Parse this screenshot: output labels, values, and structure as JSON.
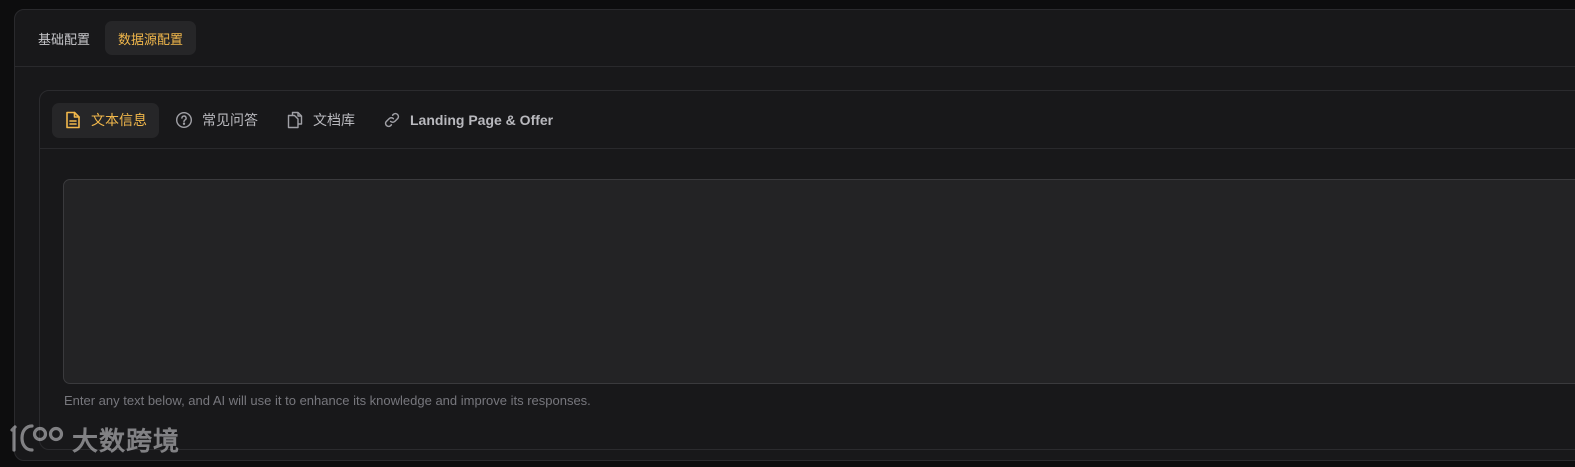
{
  "top_tabs": [
    {
      "label": "基础配置",
      "active": false
    },
    {
      "label": "数据源配置",
      "active": true
    }
  ],
  "sub_tabs": [
    {
      "label": "文本信息",
      "icon": "document-icon",
      "active": true
    },
    {
      "label": "常见问答",
      "icon": "question-circle-icon",
      "active": false
    },
    {
      "label": "文档库",
      "icon": "copy-icon",
      "active": false
    },
    {
      "label": "Landing Page & Offer",
      "icon": "link-icon",
      "active": false
    }
  ],
  "text_input": {
    "value": "",
    "placeholder": ""
  },
  "hint": "Enter any text below, and AI will use it to enhance its knowledge and improve its responses.",
  "watermark": {
    "text": "大数跨境",
    "logo": "100-logo"
  },
  "colors": {
    "accent": "#f2b84b",
    "background": "#18181a",
    "text_muted": "#77777d"
  }
}
